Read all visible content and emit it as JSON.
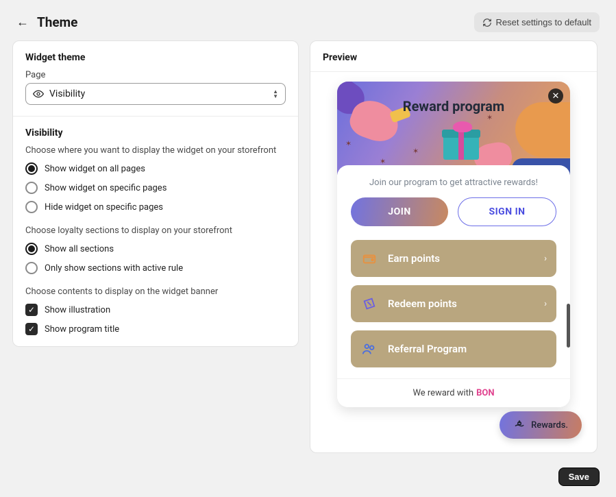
{
  "header": {
    "title": "Theme",
    "reset_label": "Reset settings to default"
  },
  "left_panel": {
    "widget_theme_title": "Widget theme",
    "page_label": "Page",
    "page_select_value": "Visibility",
    "visibility_title": "Visibility",
    "placement_subhead": "Choose where you want to display the widget on your storefront",
    "placement_options": [
      "Show widget on all pages",
      "Show widget on specific pages",
      "Hide widget on specific pages"
    ],
    "placement_selected": 0,
    "sections_subhead": "Choose loyalty sections to display on your storefront",
    "sections_options": [
      "Show all sections",
      "Only show sections with active rule"
    ],
    "sections_selected": 0,
    "banner_subhead": "Choose contents to display on the widget banner",
    "banner_checks": [
      {
        "label": "Show illustration",
        "checked": true
      },
      {
        "label": "Show program title",
        "checked": true
      }
    ]
  },
  "preview": {
    "title": "Preview",
    "banner_title": "Reward program",
    "join_text": "Join our program to get attractive rewards!",
    "join_button": "JOIN",
    "signin_button": "SIGN IN",
    "items": [
      "Earn points",
      "Redeem points",
      "Referral Program"
    ],
    "footer_prefix": "We reward with",
    "footer_brand": "BON",
    "launcher_label": "Rewards."
  },
  "footer": {
    "save_label": "Save"
  }
}
